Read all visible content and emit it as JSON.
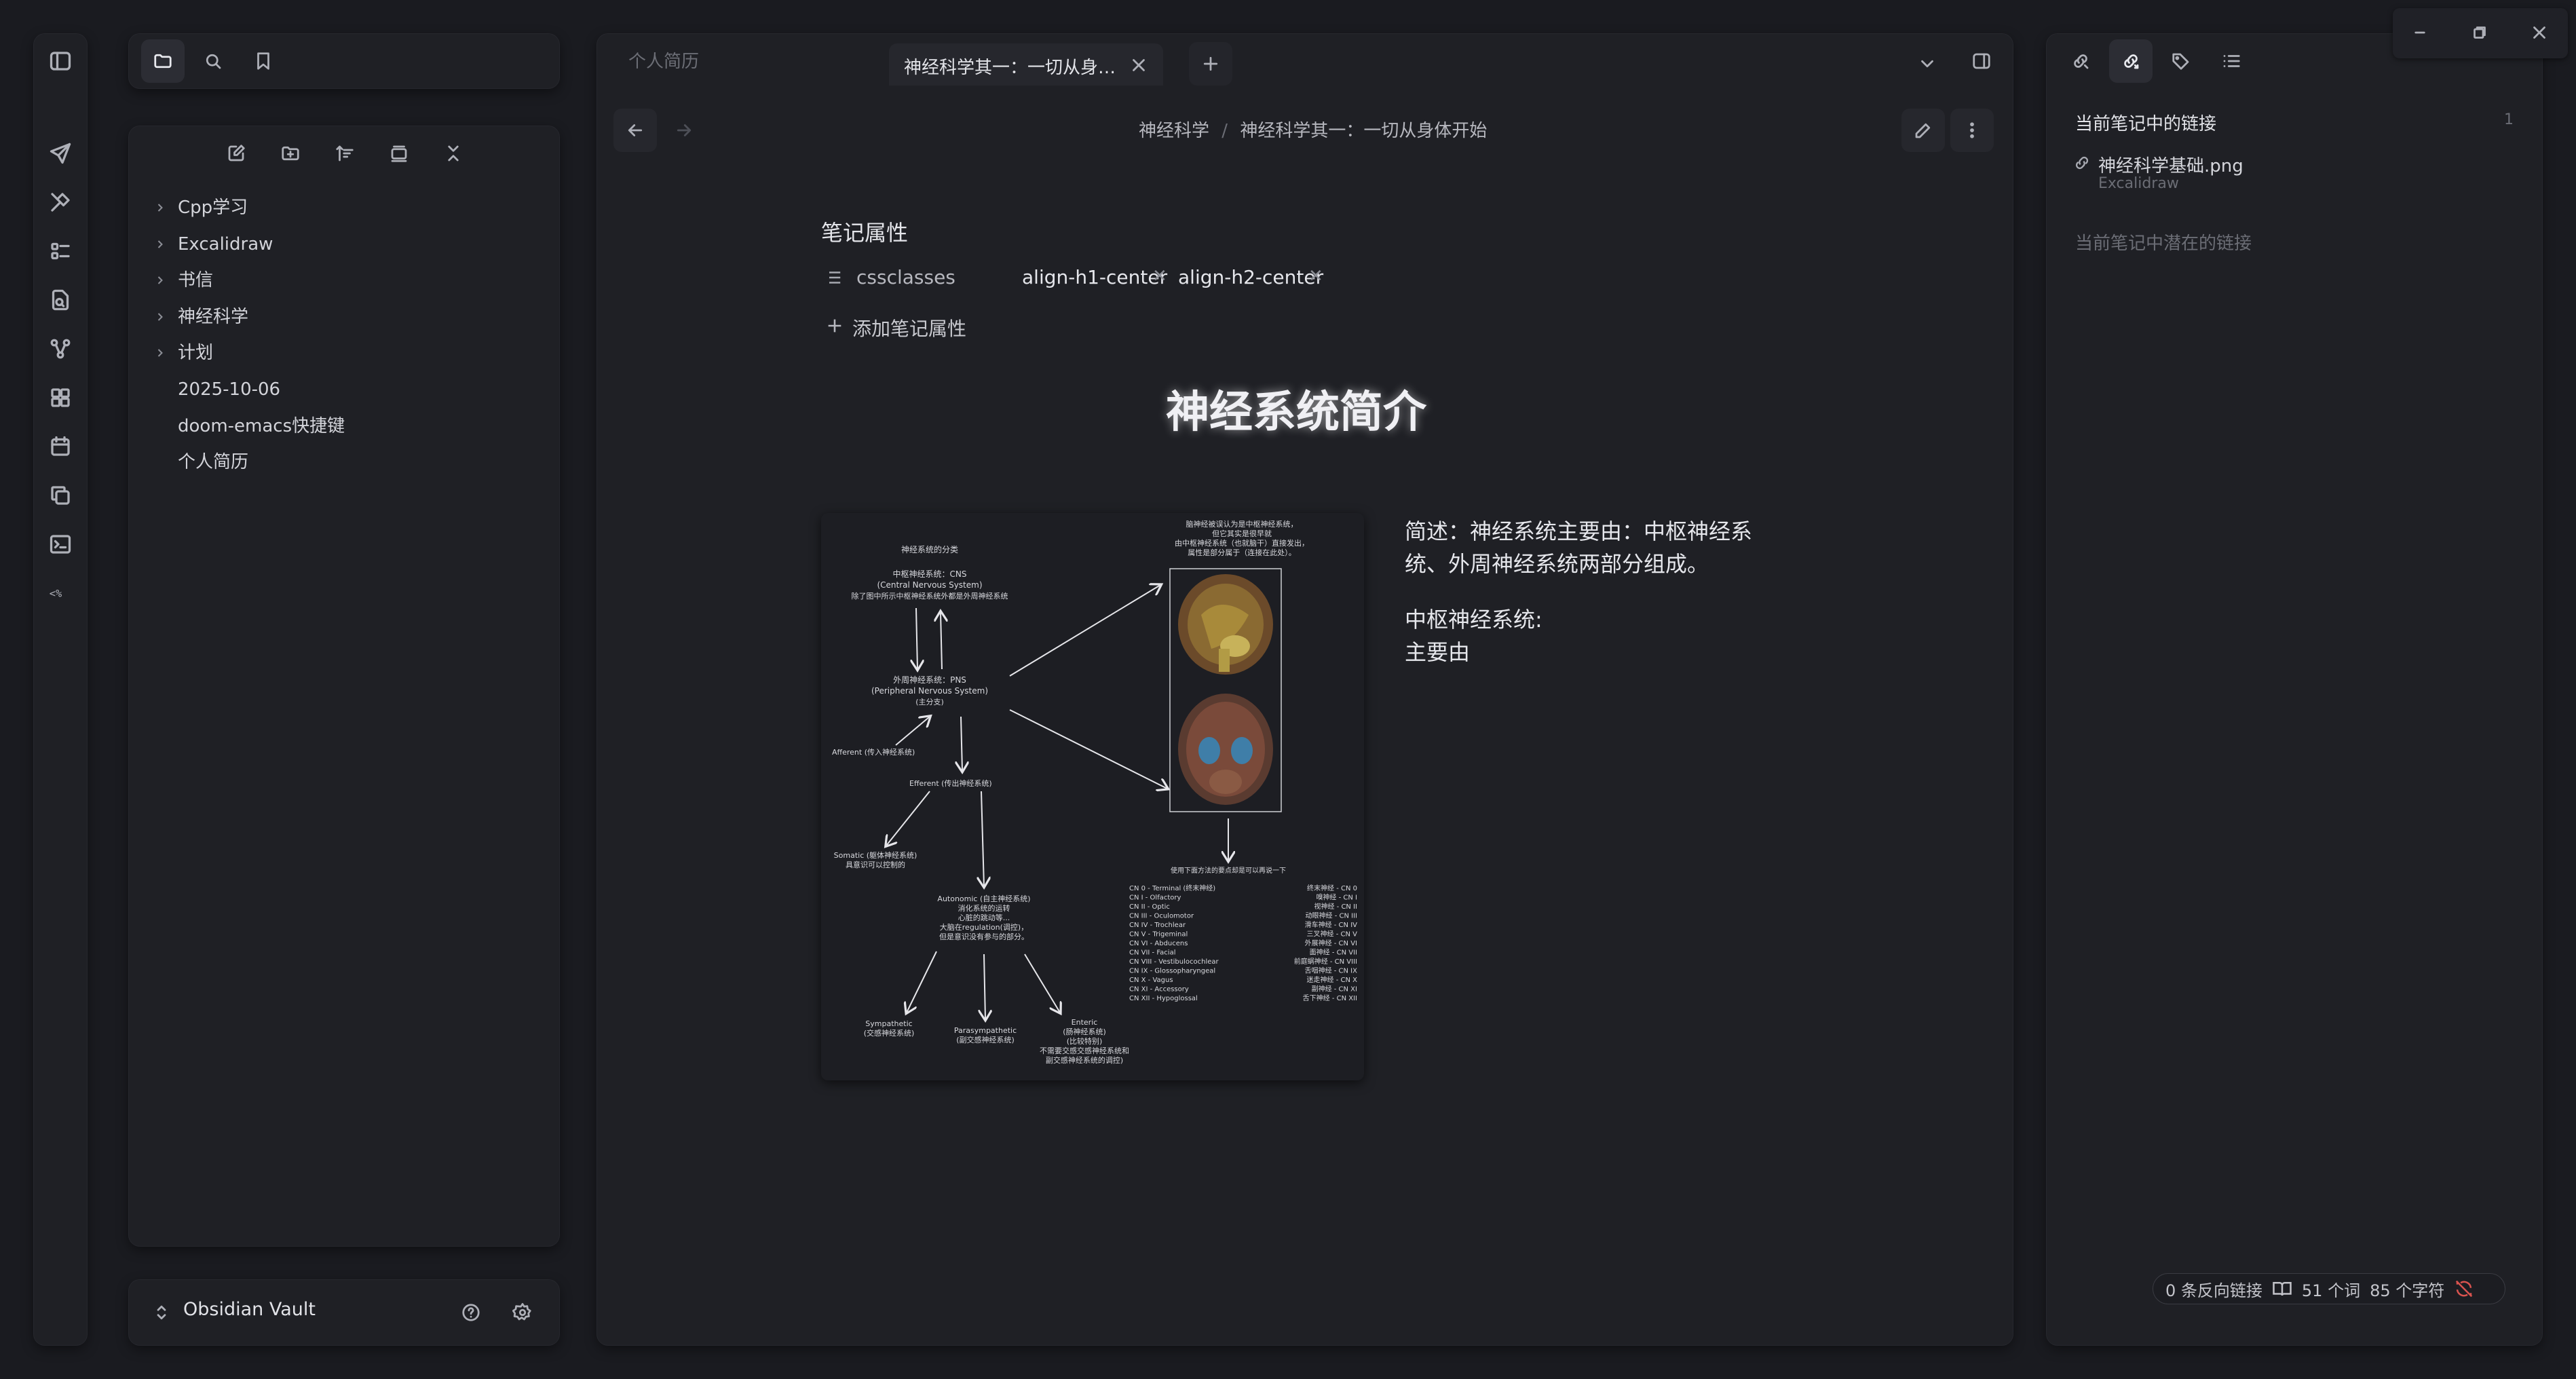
{
  "left_ribbon": {
    "icons": [
      "toggle-sidebar-icon",
      "send-icon",
      "brush-icon",
      "list-icon",
      "file-search-icon",
      "graph-icon",
      "blocks-icon",
      "calendar-icon",
      "copy-icon",
      "terminal-icon",
      "template-icon"
    ]
  },
  "file_explorer": {
    "tabs": [
      "folder-icon",
      "search-icon",
      "bookmark-icon"
    ],
    "toolbar": [
      "new-note-icon",
      "new-folder-icon",
      "sort-icon",
      "collapse-icon",
      "expand-icon"
    ],
    "items": [
      {
        "label": "Cpp学习",
        "folder": true
      },
      {
        "label": "Excalidraw",
        "folder": true
      },
      {
        "label": "书信",
        "folder": true
      },
      {
        "label": "神经科学",
        "folder": true
      },
      {
        "label": "计划",
        "folder": true
      },
      {
        "label": "2025-10-06",
        "folder": false
      },
      {
        "label": "doom-emacs快捷键",
        "folder": false
      },
      {
        "label": "个人简历",
        "folder": false
      }
    ],
    "vault_name": "Obsidian Vault"
  },
  "tabs": {
    "inactive_tab": "个人简历",
    "active_tab": "神经科学其一：一切从身…",
    "new_tab": "+"
  },
  "breadcrumb": {
    "folder": "神经科学",
    "separator": "/",
    "note": "神经科学其一：一切从身体开始"
  },
  "properties": {
    "heading": "笔记属性",
    "key": "cssclasses",
    "values": [
      "align-h1-center",
      "align-h2-center"
    ],
    "add_label": "添加笔记属性"
  },
  "note": {
    "h1": "神经系统简介",
    "para1_line1": "简述：神经系统主要由：中枢神经系",
    "para1_line2": "统、外周神经系统两部分组成。",
    "para2_line1": "中枢神经系统:",
    "para2_line2": "主要由"
  },
  "diagram": {
    "title": "神经系统的分类",
    "cns_1": "中枢神经系统：CNS",
    "cns_2": "(Central Nervous System)",
    "cns_3": "除了图中所示中枢神经系统外都是外周神经系统",
    "pns_1": "外周神经系统：PNS",
    "pns_2": "(Peripheral Nervous System)",
    "pns_3": "(主分支)",
    "afferent": "Afferent (传入神经系统)",
    "efferent": "Efferent (传出神经系统)",
    "somatic_1": "Somatic (躯体神经系统)",
    "somatic_2": "具意识可以控制的",
    "auto_1": "Autonomic (自主神经系统)",
    "auto_2": "消化系统的运转",
    "auto_3": "心脏的跳动等...",
    "auto_4": "大脑在regulation(调控)，",
    "auto_5": "但是意识没有参与的部分。",
    "symp_1": "Sympathetic",
    "symp_2": "(交感神经系统)",
    "para_1": "Parasympathetic",
    "para_2": "(副交感神经系统)",
    "ent_1": "Enteric",
    "ent_2": "(肠神经系统)",
    "ent_3": "(比较特别)",
    "ent_4": "不需要交感交感神经系统和",
    "ent_5": "副交感神经系统的调控)",
    "top_1": "脑神经被误认为是中枢神经系统，",
    "top_2": "但它其实是很早就",
    "top_3": "由中枢神经系统（也就脑干）直接发出，",
    "top_4": "属性是部分属于（连接在此处）。",
    "cranial_caption": "使用下面方法的要点却是可以再说一下",
    "cranial_left": [
      "CN 0 - Terminal (终末神经)",
      "CN I - Olfactory",
      "CN II - Optic",
      "CN III - Oculomotor",
      "CN IV - Trochlear",
      "CN V - Trigeminal",
      "CN VI - Abducens",
      "CN VII - Facial",
      "CN VIII - Vestibulocochlear",
      "CN IX - Glossopharyngeal",
      "CN X - Vagus",
      "CN XI - Accessory",
      "CN XII - Hypoglossal"
    ],
    "cranial_right": [
      "终末神经 - CN 0",
      "嗅神经 - CN I",
      "视神经 - CN II",
      "动眼神经 - CN III",
      "滑车神经 - CN IV",
      "三叉神经 - CN V",
      "外展神经 - CN VI",
      "面神经 - CN VII",
      "前庭蜗神经 - CN VIII",
      "舌咽神经 - CN IX",
      "迷走神经 - CN X",
      "副神经 - CN XI",
      "舌下神经 - CN XII"
    ]
  },
  "right_sidebar": {
    "tabs": [
      "backlinks-icon",
      "outgoing-links-icon",
      "tags-icon",
      "outline-icon"
    ],
    "section_title": "当前笔记中的链接",
    "count": "1",
    "link_name": "神经科学基础.png",
    "link_sub": "Excalidraw",
    "unlinked_title": "当前笔记中潜在的链接"
  },
  "status_bar": {
    "backlinks": "0 条反向链接",
    "words": "51 个词",
    "chars": "85 个字符"
  },
  "colors": {
    "bg": "#1a1b20",
    "panel": "#1f2025",
    "accent_red": "#d9534f"
  }
}
